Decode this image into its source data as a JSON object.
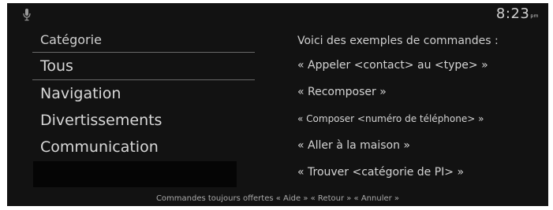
{
  "status_bar": {
    "mic_icon": "microphone-icon",
    "time": "8:23",
    "ampm": "pm"
  },
  "categories": {
    "header": "Catégorie",
    "items": [
      "Tous",
      "Navigation",
      "Divertissements",
      "Communication"
    ]
  },
  "examples": {
    "title": "Voici des exemples de commandes :",
    "items": [
      "« Appeler <contact> au <type> »",
      "« Recomposer »",
      "« Composer <numéro de téléphone> »",
      "« Aller à la maison »",
      "« Trouver <catégorie de PI> »"
    ]
  },
  "footer": "Commandes toujours offertes « Aide » « Retour » « Annuler »",
  "colors": {
    "background": "#121212",
    "text": "#d6d6d6"
  }
}
